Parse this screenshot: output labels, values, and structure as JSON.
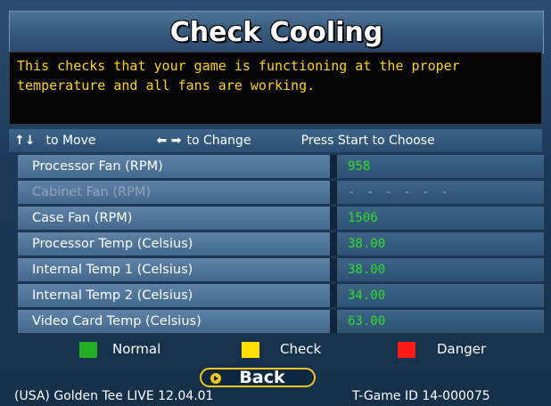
{
  "title": "Check Cooling",
  "description": "This checks that your game is functioning at the proper temperature and all fans are working.",
  "help": {
    "move": "to Move",
    "change": "to Change",
    "choose": "Press Start to Choose"
  },
  "rows": [
    {
      "label": "Processor Fan (RPM)",
      "value": "958",
      "enabled": true
    },
    {
      "label": "Cabinet Fan (RPM)",
      "value": "- - - - - -",
      "enabled": false
    },
    {
      "label": "Case Fan (RPM)",
      "value": "1506",
      "enabled": true
    },
    {
      "label": "Processor Temp (Celsius)",
      "value": "38.00",
      "enabled": true
    },
    {
      "label": "Internal Temp 1 (Celsius)",
      "value": "38.00",
      "enabled": true
    },
    {
      "label": "Internal Temp 2 (Celsius)",
      "value": "34.00",
      "enabled": true
    },
    {
      "label": "Video Card Temp (Celsius)",
      "value": "63.00",
      "enabled": true
    }
  ],
  "legend": {
    "normal": {
      "label": "Normal",
      "color": "#22b022"
    },
    "check": {
      "label": "Check",
      "color": "#ffe000"
    },
    "danger": {
      "label": "Danger",
      "color": "#ff1a1a"
    }
  },
  "back_label": "Back",
  "footer": {
    "version": "(USA) Golden Tee LIVE 12.04.01",
    "game_id": "T-Game ID 14-000075"
  }
}
